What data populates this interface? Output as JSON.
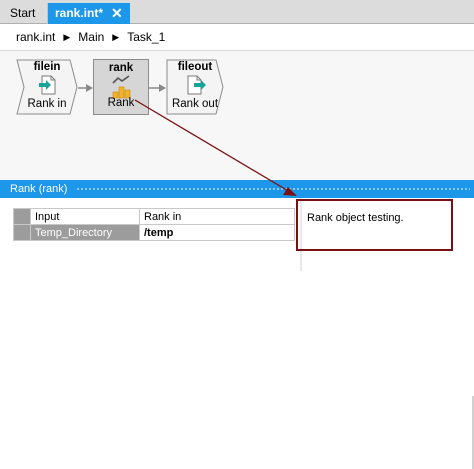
{
  "tabs": [
    {
      "label": "Start"
    },
    {
      "label": "rank.int*",
      "close": "✕"
    }
  ],
  "breadcrumb": [
    "rank.int",
    "Main",
    "Task_1"
  ],
  "breadcrumb_sep": "▶",
  "nodes": {
    "filein": {
      "title": "filein",
      "label": "Rank in"
    },
    "rank": {
      "title": "rank",
      "label": "Rank"
    },
    "fileout": {
      "title": "fileout",
      "label": "Rank out"
    }
  },
  "panel": {
    "title": "Rank (rank)",
    "rows": [
      {
        "key": "Input",
        "value": "Rank in"
      },
      {
        "key": "Temp_Directory",
        "value": "/temp"
      }
    ],
    "description": "Rank object testing."
  },
  "colors": {
    "accent": "#1c97ea",
    "annotation": "#7b1013"
  }
}
